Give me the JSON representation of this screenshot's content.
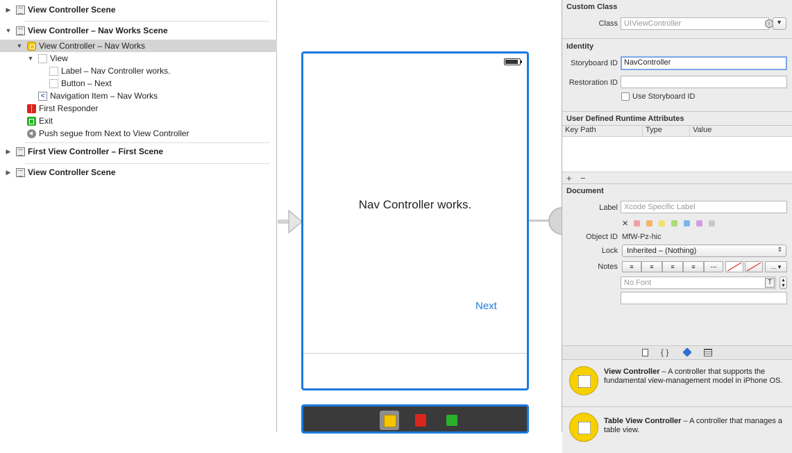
{
  "outline": {
    "rows": [
      {
        "label": "View Controller Scene"
      },
      {
        "label": "View Controller – Nav Works Scene"
      },
      {
        "label": "View Controller – Nav Works"
      },
      {
        "label": "View"
      },
      {
        "label": "Label – Nav Controller works."
      },
      {
        "label": "Button – Next"
      },
      {
        "label": "Navigation Item – Nav Works"
      },
      {
        "label": "First Responder"
      },
      {
        "label": "Exit"
      },
      {
        "label": "Push segue from Next to View Controller"
      },
      {
        "label": "First View Controller – First Scene"
      },
      {
        "label": "View Controller Scene"
      }
    ]
  },
  "canvas": {
    "label_text": "Nav Controller works.",
    "next_button": "Next"
  },
  "inspector": {
    "custom_class": {
      "title": "Custom Class",
      "class_label": "Class",
      "class_placeholder": "UIViewController"
    },
    "identity": {
      "title": "Identity",
      "storyboard_id_label": "Storyboard ID",
      "storyboard_id_value": "NavController",
      "restoration_id_label": "Restoration ID",
      "restoration_id_value": "",
      "use_storyboard_id_label": "Use Storyboard ID"
    },
    "runtime_attributes": {
      "title": "User Defined Runtime Attributes",
      "columns": [
        "Key Path",
        "Type",
        "Value"
      ],
      "add": "+",
      "remove": "−"
    },
    "document": {
      "title": "Document",
      "label_label": "Label",
      "label_placeholder": "Xcode Specific Label",
      "clear": "✕",
      "colors": [
        "#f0a0a0",
        "#f5b46a",
        "#f3e06a",
        "#a9dc7a",
        "#7db6ee",
        "#d79be4",
        "#c8c8c8"
      ],
      "object_id_label": "Object ID",
      "object_id_value": "MfW-Pz-hic",
      "lock_label": "Lock",
      "lock_value": "Inherited – (Nothing)",
      "notes_label": "Notes",
      "font_placeholder": "No Font",
      "more": "..."
    },
    "library_tabs": [
      "file-icon",
      "braces-icon",
      "cube-icon",
      "grid-icon"
    ],
    "library": [
      {
        "title": "View Controller",
        "desc": " – A controller that supports the fundamental view-management model in iPhone OS."
      },
      {
        "title": "Table View Controller",
        "desc": " – A controller that manages a table view."
      }
    ]
  }
}
